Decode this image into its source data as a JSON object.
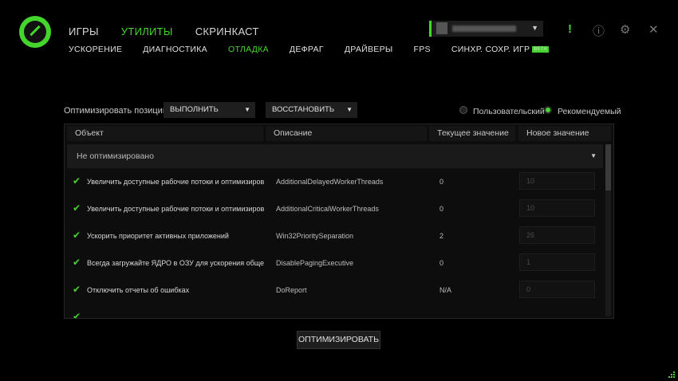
{
  "nav": {
    "tabs": [
      {
        "label": "ИГРЫ"
      },
      {
        "label": "УТИЛИТЫ"
      },
      {
        "label": "СКРИНКАСТ"
      }
    ],
    "subtabs": [
      {
        "label": "УСКОРЕНИЕ"
      },
      {
        "label": "ДИАГНОСТИКА"
      },
      {
        "label": "ОТЛАДКА"
      },
      {
        "label": "ДЕФРАГ"
      },
      {
        "label": "ДРАЙВЕРЫ"
      },
      {
        "label": "FPS"
      },
      {
        "label": "СИНХР. СОХР. ИГР"
      }
    ],
    "beta_label": "BETA"
  },
  "header": {
    "alert_icon": "!",
    "info_icon": "ⓘ",
    "settings_icon": "⚙",
    "close_icon": "✕"
  },
  "controls": {
    "label": "Оптимизировать позиции",
    "execute": "ВЫПОЛНИТЬ",
    "restore": "ВОССТАНОВИТЬ",
    "custom_label": "Пользовательский",
    "recommended_label": "Рекомендуемый"
  },
  "table": {
    "headers": [
      "Объект",
      "Описание",
      "Текущее значение",
      "Новое значение"
    ],
    "group": "Не оптимизировано",
    "rows": [
      {
        "object": "Увеличить доступные рабочие потоки и оптимизировать и",
        "description": "AdditionalDelayedWorkerThreads",
        "current": "0",
        "new": "10"
      },
      {
        "object": "Увеличить доступные рабочие потоки и оптимизировать и",
        "description": "AdditionalCriticalWorkerThreads",
        "current": "0",
        "new": "10"
      },
      {
        "object": "Ускорить приоритет активных приложений",
        "description": "Win32PrioritySeparation",
        "current": "2",
        "new": "26"
      },
      {
        "object": "Всегда загружайте ЯДРО в ОЗУ для ускорения общей прои",
        "description": "DisablePagingExecutive",
        "current": "0",
        "new": "1"
      },
      {
        "object": "Отключить отчеты об ошибках",
        "description": "DoReport",
        "current": "N/A",
        "new": "0"
      }
    ]
  },
  "footer": {
    "optimize_button": "ОПТИМИЗИРОВАТЬ"
  },
  "colors": {
    "accent": "#44d62c",
    "background": "#000000"
  }
}
